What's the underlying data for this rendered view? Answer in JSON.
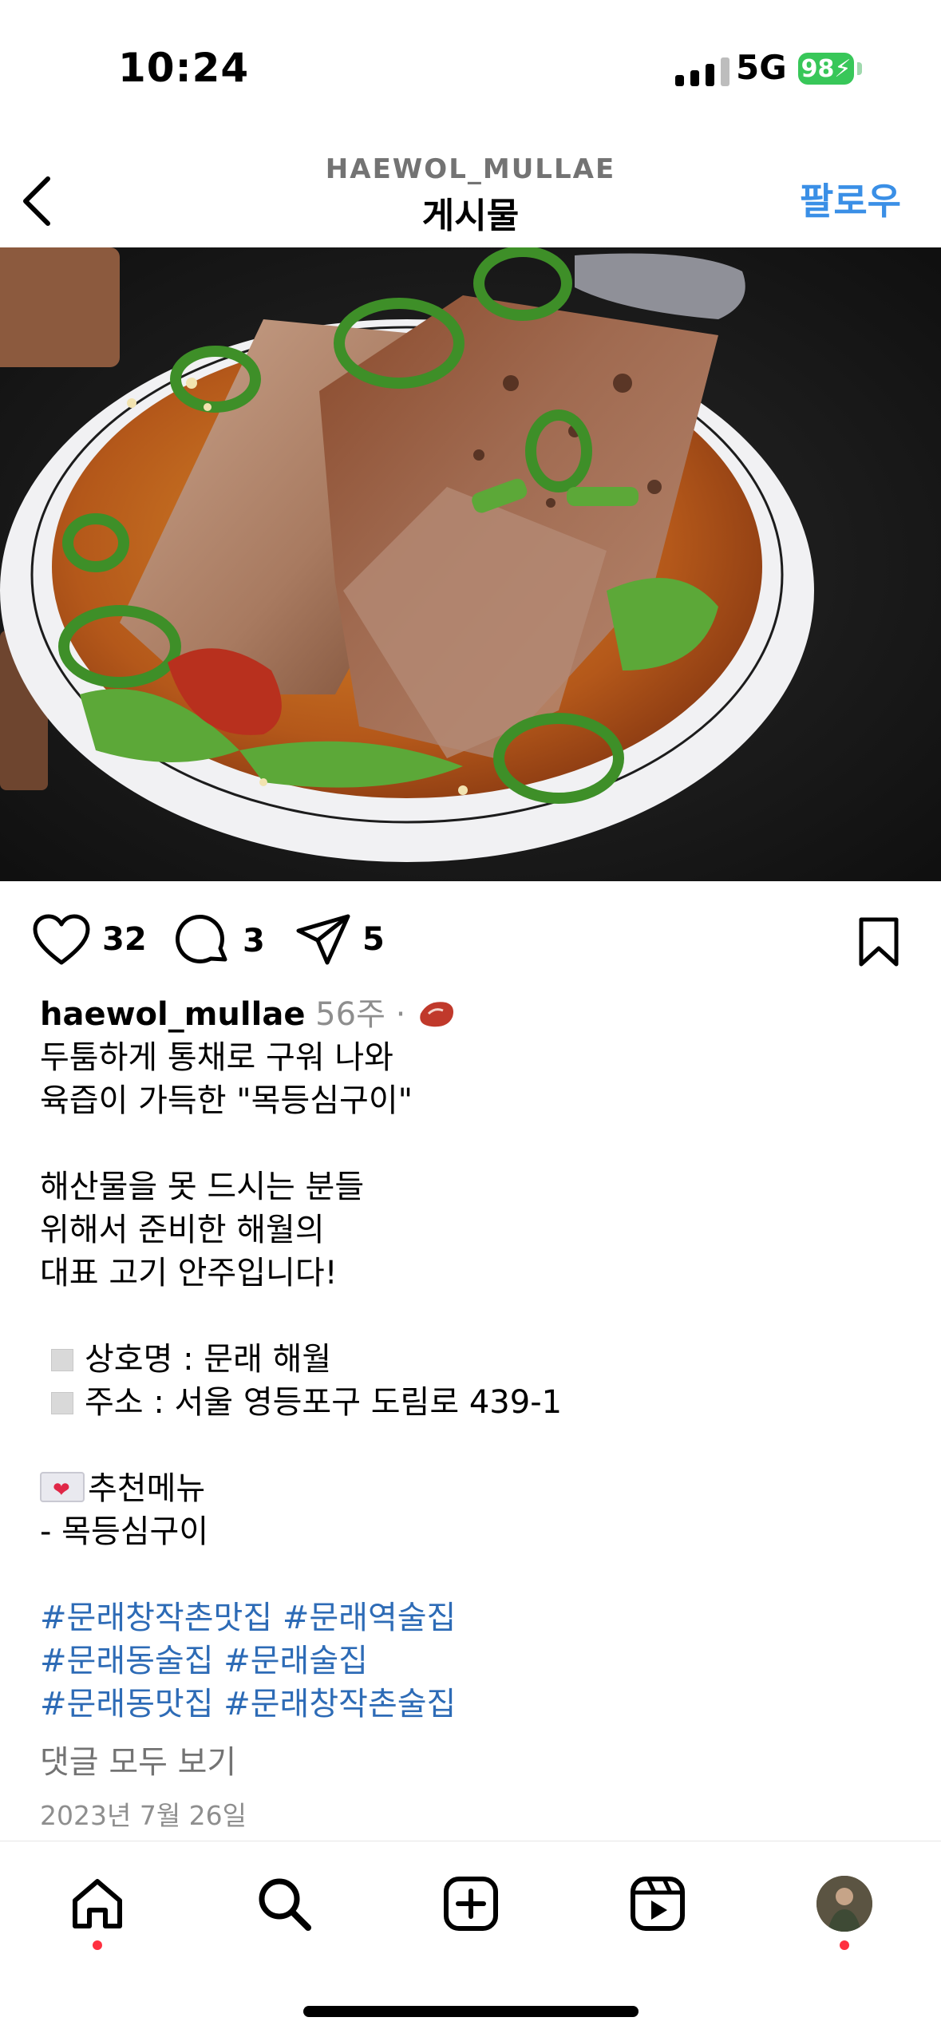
{
  "status_bar": {
    "time": "10:24",
    "network": "5G",
    "battery": "98"
  },
  "header": {
    "username": "HAEWOL_MULLAE",
    "title": "게시물",
    "follow_label": "팔로우"
  },
  "actions": {
    "likes": "32",
    "comments": "3",
    "shares": "5"
  },
  "caption": {
    "username": "haewol_mullae",
    "meta": "56주 ·",
    "lines": [
      "두툼하게 통채로 구워 나와",
      "육즙이 가득한 \"목등심구이\"",
      "해산물을 못 드시는 분들",
      "위해서 준비한 해월의",
      "대표 고기 안주입니다!",
      "상호명 : 문래 해월",
      "주소 : 서울 영등포구 도림로 439-1",
      "추천메뉴",
      "- 목등심구이"
    ],
    "hashtags": [
      "#문래창작촌맛집 #문래역술집",
      "#문래동술집 #문래술집",
      "#문래동맛집 #문래창작촌술집"
    ]
  },
  "view_comments_label": "댓글 모두 보기",
  "date": "2023년 7월 26일",
  "icons": [
    "back-arrow-icon",
    "heart-icon",
    "comment-icon",
    "share-icon",
    "bookmark-icon",
    "home-icon",
    "search-icon",
    "create-icon",
    "reels-icon",
    "profile-avatar"
  ],
  "colors": {
    "accent": "#3a8fe6",
    "hashtag": "#2d6bb6",
    "notification_dot": "#ff3040",
    "battery": "#38c759"
  }
}
